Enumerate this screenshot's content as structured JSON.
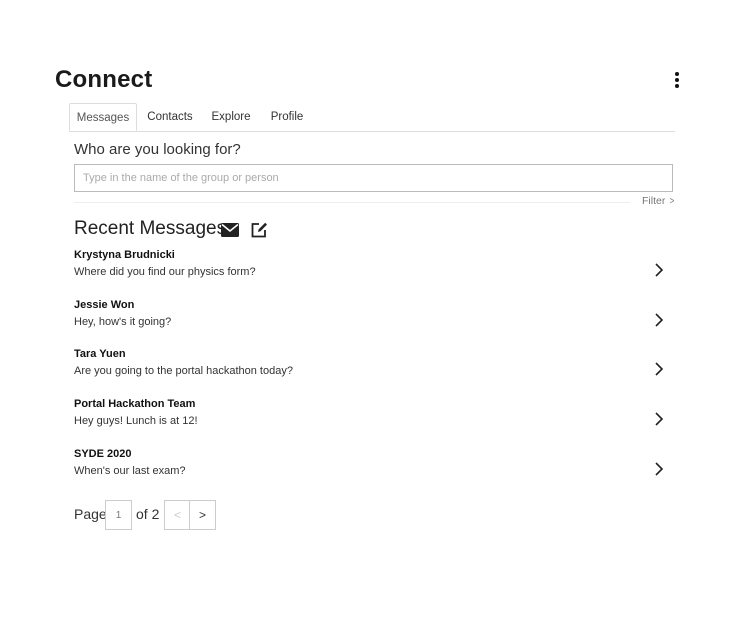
{
  "header": {
    "title": "Connect",
    "menu_icon": "more-vertical-icon"
  },
  "tabs": [
    {
      "label": "Messages",
      "active": true
    },
    {
      "label": "Contacts",
      "active": false
    },
    {
      "label": "Explore",
      "active": false
    },
    {
      "label": "Profile",
      "active": false
    }
  ],
  "search": {
    "heading": "Who are you looking for?",
    "placeholder": "Type in the name of the group or person",
    "value": "",
    "filter_label": "Filter"
  },
  "recent": {
    "title": "Recent Messages",
    "icons": [
      "envelope-icon",
      "compose-icon"
    ],
    "messages": [
      {
        "sender": "Krystyna Brudnicki",
        "preview": "Where did you find our physics form?"
      },
      {
        "sender": "Jessie Won",
        "preview": "Hey, how's it going?"
      },
      {
        "sender": "Tara Yuen",
        "preview": "Are you going to the portal hackathon today?"
      },
      {
        "sender": "Portal Hackathon Team",
        "preview": "Hey guys! Lunch is at 12!"
      },
      {
        "sender": "SYDE 2020",
        "preview": "When's our last exam?"
      }
    ]
  },
  "pagination": {
    "page_label": "Page",
    "current_page": "1",
    "of_label": "of 2",
    "prev_label": "<",
    "next_label": ">"
  }
}
